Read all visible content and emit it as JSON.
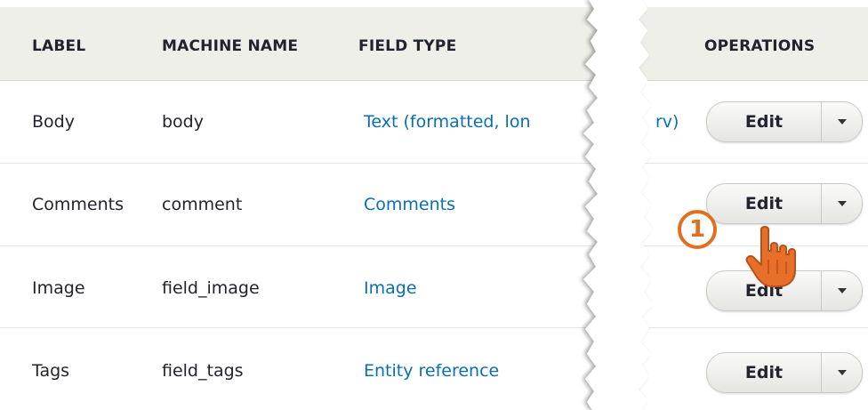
{
  "table": {
    "headers": {
      "label": "LABEL",
      "machine_name": "MACHINE NAME",
      "field_type": "FIELD TYPE",
      "operations": "OPERATIONS"
    },
    "rows": [
      {
        "label": "Body",
        "machine_name": "body",
        "field_type_left": "Text (formatted, lon",
        "field_type_right": "rv)",
        "edit_label": "Edit"
      },
      {
        "label": "Comments",
        "machine_name": "comment",
        "field_type_left": "Comments",
        "field_type_right": "",
        "edit_label": "Edit"
      },
      {
        "label": "Image",
        "machine_name": "field_image",
        "field_type_left": "Image",
        "field_type_right": "",
        "edit_label": "Edit"
      },
      {
        "label": "Tags",
        "machine_name": "field_tags",
        "field_type_left": "Entity reference",
        "field_type_right": "",
        "edit_label": "Edit"
      }
    ]
  },
  "callout": {
    "number": "1"
  },
  "icons": {
    "dropdown": "caret-down-icon",
    "pointer": "hand-pointer-icon",
    "torn": "torn-edge-divider"
  },
  "colors": {
    "header_bg": "#efefea",
    "link": "#0a6eb4",
    "callout": "#e07020"
  }
}
